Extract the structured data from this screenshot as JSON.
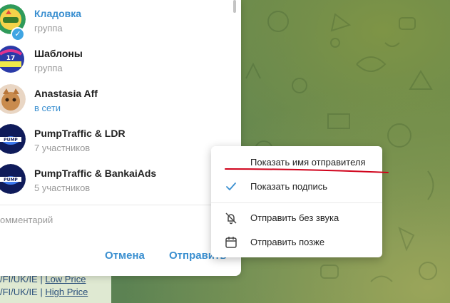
{
  "chats": [
    {
      "name": "Кладовка",
      "status": "группа",
      "selected": true,
      "avatar": "kladovka-avatar"
    },
    {
      "name": "Шаблоны",
      "status": "группа",
      "selected": false,
      "avatar": "shablony-avatar"
    },
    {
      "name": "Anastasia Aff",
      "status": "в сети",
      "selected": false,
      "avatar": "anastasia-avatar"
    },
    {
      "name": "PumpTraffic & LDR",
      "status": "7 участников",
      "selected": false,
      "avatar": "pumptraffic-avatar"
    },
    {
      "name": "PumpTraffic & BankaiAds",
      "status": "5 участников",
      "selected": false,
      "avatar": "pumptraffic-avatar"
    }
  ],
  "comment": {
    "placeholder": "омментарий"
  },
  "buttons": {
    "cancel": "Отмена",
    "send": "Отправить"
  },
  "menu": {
    "items": [
      {
        "label": "Показать имя отправителя",
        "icon": "none",
        "checked": false
      },
      {
        "label": "Показать подпись",
        "icon": "check-icon",
        "checked": true
      },
      {
        "label": "Отправить без звука",
        "icon": "muted-bell-icon",
        "checked": false
      },
      {
        "label": "Отправить позже",
        "icon": "calendar-icon",
        "checked": false
      }
    ]
  },
  "background_message": {
    "line1_prefix": "/FI/UK/IE | ",
    "line1_link": "Low Price",
    "line2_prefix": "/FI/UK/IE | ",
    "line2_link": "High Price"
  },
  "colors": {
    "accent": "#3a8fd0",
    "annotation": "#d0021b",
    "wallpaper": "#6b8a48"
  }
}
